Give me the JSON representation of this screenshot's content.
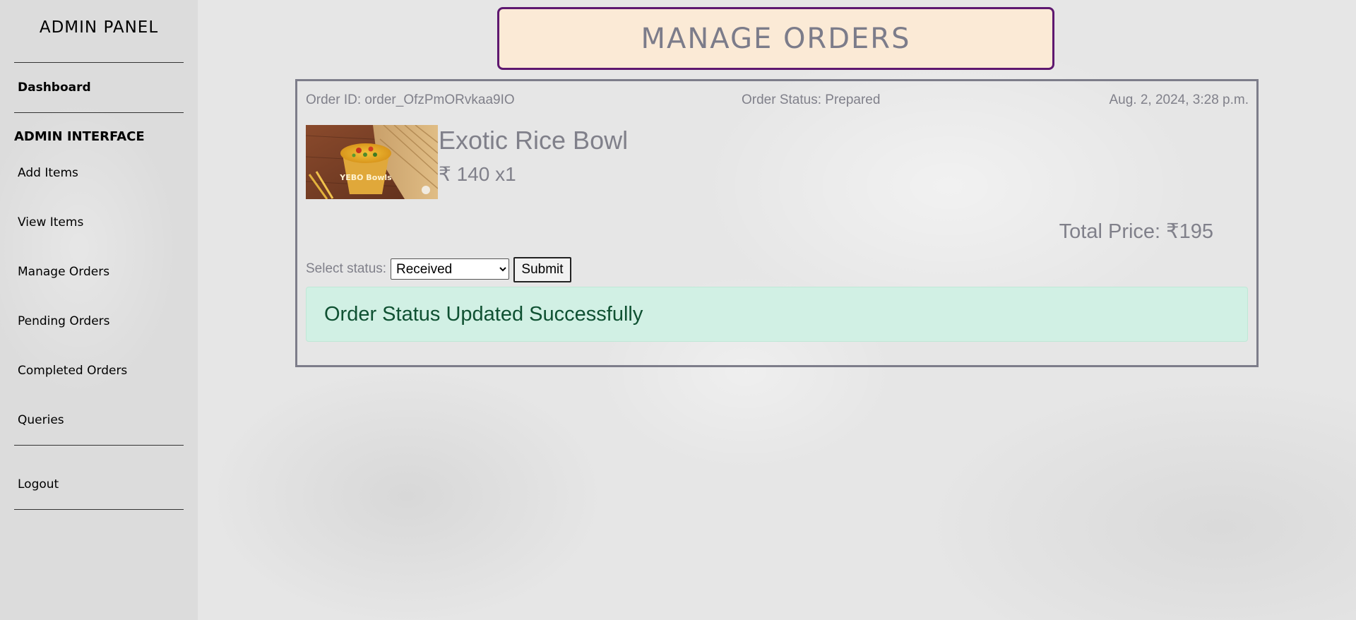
{
  "sidebar": {
    "brand": "ADMIN PANEL",
    "dashboard_label": "Dashboard",
    "section_heading": "ADMIN INTERFACE",
    "items": [
      {
        "label": "Add Items"
      },
      {
        "label": "View Items"
      },
      {
        "label": "Manage Orders"
      },
      {
        "label": "Pending Orders"
      },
      {
        "label": "Completed Orders"
      },
      {
        "label": "Queries"
      }
    ],
    "logout_label": "Logout"
  },
  "page": {
    "title": "MANAGE ORDERS"
  },
  "order": {
    "id_text": "Order ID: order_OfzPmORvkaa9IO",
    "status_text": "Order Status: Prepared",
    "datetime": "Aug. 2, 2024, 3:28 p.m.",
    "item": {
      "name": "Exotic Rice Bowl",
      "price_qty": "₹ 140 x1",
      "image_brand_text": "YEBO Bowls"
    },
    "total_text": "Total Price: ₹195",
    "status_form": {
      "label": "Select status:",
      "selected": "Received",
      "submit_label": "Submit"
    },
    "alert_message": "Order Status Updated Successfully"
  },
  "colors": {
    "title_bg": "#fbead6",
    "title_border": "#5e1870",
    "muted_text": "#80808a",
    "alert_bg": "#d1f0e4",
    "alert_text": "#0f5132"
  }
}
